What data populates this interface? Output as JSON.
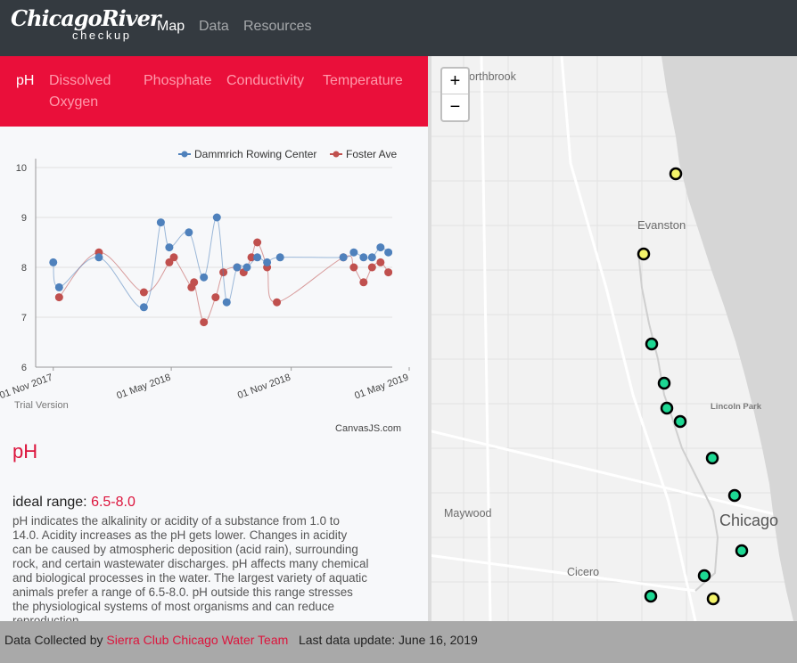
{
  "navbar": {
    "logo_main": "ChicagoRiver",
    "logo_sub": "checkup",
    "links": [
      "Map",
      "Data",
      "Resources"
    ]
  },
  "tabs": [
    "pH",
    "Dissolved Oxygen",
    "Phosphate",
    "Conductivity",
    "Temperature"
  ],
  "active_tab": "pH",
  "chart_data": {
    "type": "line",
    "y_ticks": [
      "10",
      "9",
      "8",
      "7",
      "6"
    ],
    "x_ticks": [
      "01 Nov 2017",
      "01 May 2018",
      "01 Nov 2018",
      "01 May 2019"
    ],
    "ylim": [
      6,
      10
    ],
    "watermark": "Trial Version",
    "credit": "CanvasJS.com",
    "series": [
      {
        "name": "Dammrich Rowing Center",
        "color": "#4f81bc",
        "x": [
          "2017-11-01",
          "2017-11-10",
          "2018-01-10",
          "2018-03-20",
          "2018-04-15",
          "2018-04-28",
          "2018-05-28",
          "2018-06-20",
          "2018-07-10",
          "2018-07-25",
          "2018-08-10",
          "2018-08-25",
          "2018-09-10",
          "2018-09-25",
          "2018-10-15",
          "2019-01-20",
          "2019-02-05",
          "2019-02-20",
          "2019-03-05",
          "2019-03-18",
          "2019-03-30"
        ],
        "values": [
          8.1,
          7.6,
          8.2,
          7.2,
          8.9,
          8.4,
          8.7,
          7.8,
          9.0,
          7.3,
          8.0,
          8.0,
          8.2,
          8.1,
          8.2,
          8.2,
          8.3,
          8.2,
          8.2,
          8.4,
          8.3
        ]
      },
      {
        "name": "Foster Ave",
        "color": "#c0504e",
        "x": [
          "2017-11-10",
          "2018-01-10",
          "2018-03-20",
          "2018-04-28",
          "2018-05-05",
          "2018-06-01",
          "2018-06-05",
          "2018-06-20",
          "2018-07-08",
          "2018-07-20",
          "2018-08-10",
          "2018-08-20",
          "2018-09-01",
          "2018-09-10",
          "2018-09-25",
          "2018-10-10",
          "2019-01-20",
          "2019-02-05",
          "2019-02-20",
          "2019-03-05",
          "2019-03-18",
          "2019-03-30"
        ],
        "values": [
          7.4,
          8.3,
          7.5,
          8.1,
          8.2,
          7.6,
          7.7,
          6.9,
          7.4,
          7.9,
          8.0,
          7.9,
          8.2,
          8.5,
          8.0,
          7.3,
          8.2,
          8.0,
          7.7,
          8.0,
          8.1,
          7.9
        ]
      }
    ]
  },
  "param": {
    "title": "pH",
    "ideal_label": "ideal range: ",
    "ideal_value": "6.5-8.0",
    "description": "pH indicates the alkalinity or acidity of a substance from 1.0 to 14.0. Acidity increases as the pH gets lower. Changes in acidity can be caused by atmospheric deposition (acid rain), surrounding rock, and certain wastewater discharges. pH affects many chemical and biological processes in the water. The largest variety of aquatic animals prefer a range of 6.5-8.0. pH outside this range stresses the physiological systems of most organisms and can reduce reproduction."
  },
  "map": {
    "zoom_in": "+",
    "zoom_out": "−",
    "labels": {
      "northbrook": "Northbrook",
      "evanston": "Evanston",
      "lincoln_park": "Lincoln Park",
      "maywood": "Maywood",
      "chicago": "Chicago",
      "cicero": "Cicero"
    },
    "markers": [
      {
        "status": "yellow"
      },
      {
        "status": "yellow"
      },
      {
        "status": "green"
      },
      {
        "status": "green"
      },
      {
        "status": "green"
      },
      {
        "status": "green"
      },
      {
        "status": "green"
      },
      {
        "status": "green"
      },
      {
        "status": "green"
      },
      {
        "status": "green"
      },
      {
        "status": "green"
      },
      {
        "status": "yellow"
      }
    ],
    "colors": {
      "green": "#1dd893",
      "yellow": "#f3f36a",
      "water": "#d6d6d6",
      "land": "#f2f2f2"
    }
  },
  "footer": {
    "prefix": "Data Collected by ",
    "link": "Sierra Club Chicago Water Team",
    "update": "Last data update: June 16, 2019"
  }
}
